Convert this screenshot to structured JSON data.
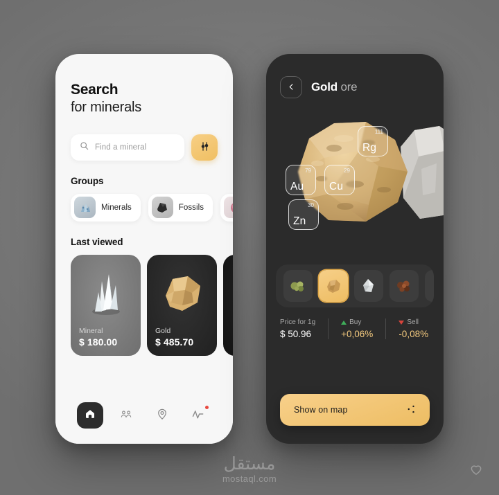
{
  "background_color": "#7b7b7b",
  "accent_color": "#f0bf62",
  "left_phone": {
    "title_bold": "Search",
    "title_light": "for minerals",
    "search": {
      "placeholder": "Find a mineral",
      "value": "",
      "icon": "search-icon",
      "filter_icon": "sliders-icon"
    },
    "groups": {
      "heading": "Groups",
      "chips": [
        {
          "label": "Minerals",
          "thumb": "blue-crystal-cluster"
        },
        {
          "label": "Fossils",
          "thumb": "black-fossil-rock"
        },
        {
          "label": "",
          "thumb": "pink-mineral"
        }
      ]
    },
    "last_viewed": {
      "heading": "Last viewed",
      "cards": [
        {
          "name": "Mineral",
          "price": "$ 180.00",
          "bg": "#7d7d7d",
          "thumb": "white-quartz-crystal"
        },
        {
          "name": "Gold",
          "price": "$ 485.70",
          "bg": "#262626",
          "thumb": "gold-nugget"
        },
        {
          "name": "",
          "price": "",
          "bg": "#1b1b1b",
          "thumb": "dark-rock"
        }
      ]
    },
    "nav": [
      {
        "icon": "home-icon",
        "active": true,
        "badge": false
      },
      {
        "icon": "people-icon",
        "active": false,
        "badge": false
      },
      {
        "icon": "location-pin-icon",
        "active": false,
        "badge": false
      },
      {
        "icon": "activity-pulse-icon",
        "active": false,
        "badge": true
      }
    ]
  },
  "right_phone": {
    "back_icon": "chevron-left-icon",
    "title_bold": "Gold",
    "title_light": "ore",
    "hero": {
      "main_rock": "gold-ore-rock",
      "side_rock": "white-quartz-rock",
      "element_badges": [
        {
          "symbol": "Rg",
          "number": "111"
        },
        {
          "symbol": "Au",
          "number": "79"
        },
        {
          "symbol": "Cu",
          "number": "29"
        },
        {
          "symbol": "Zn",
          "number": "30"
        }
      ]
    },
    "thumbnails": [
      {
        "name": "green-olivine-ore",
        "selected": false
      },
      {
        "name": "gold-ore",
        "selected": true
      },
      {
        "name": "silver-quartz",
        "selected": false
      },
      {
        "name": "copper-ore",
        "selected": false
      },
      {
        "name": "white-crystal",
        "selected": false
      }
    ],
    "stats": [
      {
        "label": "Price for 1g",
        "value": "$ 50.96",
        "trend": "none",
        "gold": false
      },
      {
        "label": "Buy",
        "value": "+0,06%",
        "trend": "up",
        "gold": true
      },
      {
        "label": "Sell",
        "value": "-0,08%",
        "trend": "down",
        "gold": true
      }
    ],
    "map_button": {
      "label": "Show on map",
      "icon": "share-dots-icon"
    }
  },
  "watermark": {
    "arabic": "مستقل",
    "latin": "mostaql.com",
    "heart_icon": "heart-icon"
  }
}
